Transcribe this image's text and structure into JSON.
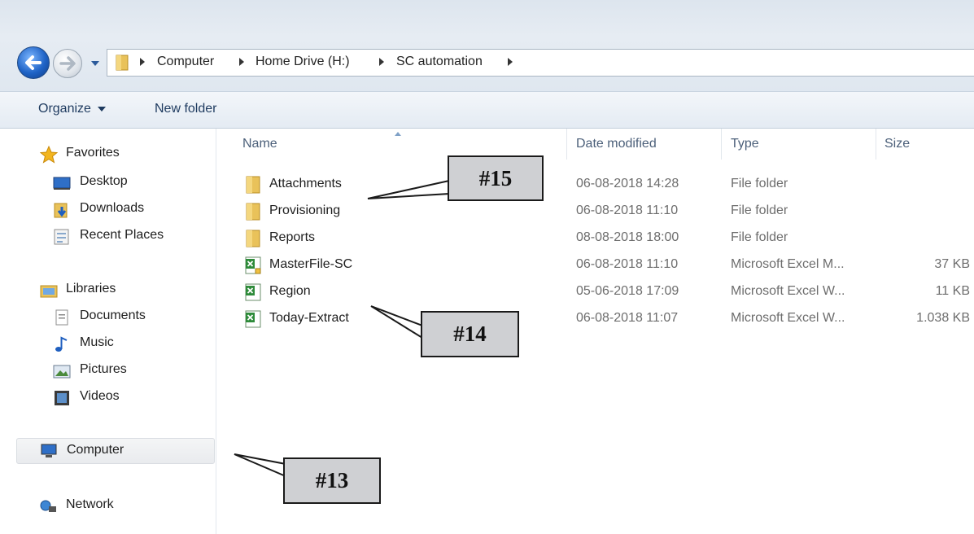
{
  "address_bar": {
    "breadcrumbs": [
      "Computer",
      "Home Drive (H:)",
      "SC automation"
    ]
  },
  "toolbar": {
    "organize_label": "Organize",
    "new_folder_label": "New folder"
  },
  "nav_pane": {
    "favorites": {
      "label": "Favorites",
      "items": [
        {
          "label": "Desktop",
          "icon": "desktop-icon"
        },
        {
          "label": "Downloads",
          "icon": "downloads-icon"
        },
        {
          "label": "Recent Places",
          "icon": "recent-places-icon"
        }
      ]
    },
    "libraries": {
      "label": "Libraries",
      "items": [
        {
          "label": "Documents",
          "icon": "documents-icon"
        },
        {
          "label": "Music",
          "icon": "music-icon"
        },
        {
          "label": "Pictures",
          "icon": "pictures-icon"
        },
        {
          "label": "Videos",
          "icon": "videos-icon"
        }
      ]
    },
    "computer": {
      "label": "Computer",
      "selected": true
    },
    "network": {
      "label": "Network"
    }
  },
  "file_list": {
    "columns": {
      "name": "Name",
      "date": "Date modified",
      "type": "Type",
      "size": "Size"
    },
    "sorted_by": "Name",
    "rows": [
      {
        "name": "Attachments",
        "date": "06-08-2018 14:28",
        "type": "File folder",
        "size": "",
        "icon": "folder-icon"
      },
      {
        "name": "Provisioning",
        "date": "06-08-2018 11:10",
        "type": "File folder",
        "size": "",
        "icon": "folder-icon"
      },
      {
        "name": "Reports",
        "date": "08-08-2018 18:00",
        "type": "File folder",
        "size": "",
        "icon": "folder-icon"
      },
      {
        "name": "MasterFile-SC",
        "date": "06-08-2018 11:10",
        "type": "Microsoft Excel M...",
        "size": "37 KB",
        "icon": "excel-macro-icon"
      },
      {
        "name": "Region",
        "date": "05-06-2018 17:09",
        "type": "Microsoft Excel W...",
        "size": "11 KB",
        "icon": "excel-icon"
      },
      {
        "name": "Today-Extract",
        "date": "06-08-2018 11:07",
        "type": "Microsoft Excel W...",
        "size": "1.038 KB",
        "icon": "excel-icon"
      }
    ]
  },
  "annotations": {
    "callout_15": "#15",
    "callout_14": "#14",
    "callout_13": "#13"
  },
  "colors": {
    "callout_fill": "#cfd0d3",
    "header_text": "#4c607a",
    "folder_yellow": "#e9c25a",
    "excel_green": "#2e8b3a"
  }
}
